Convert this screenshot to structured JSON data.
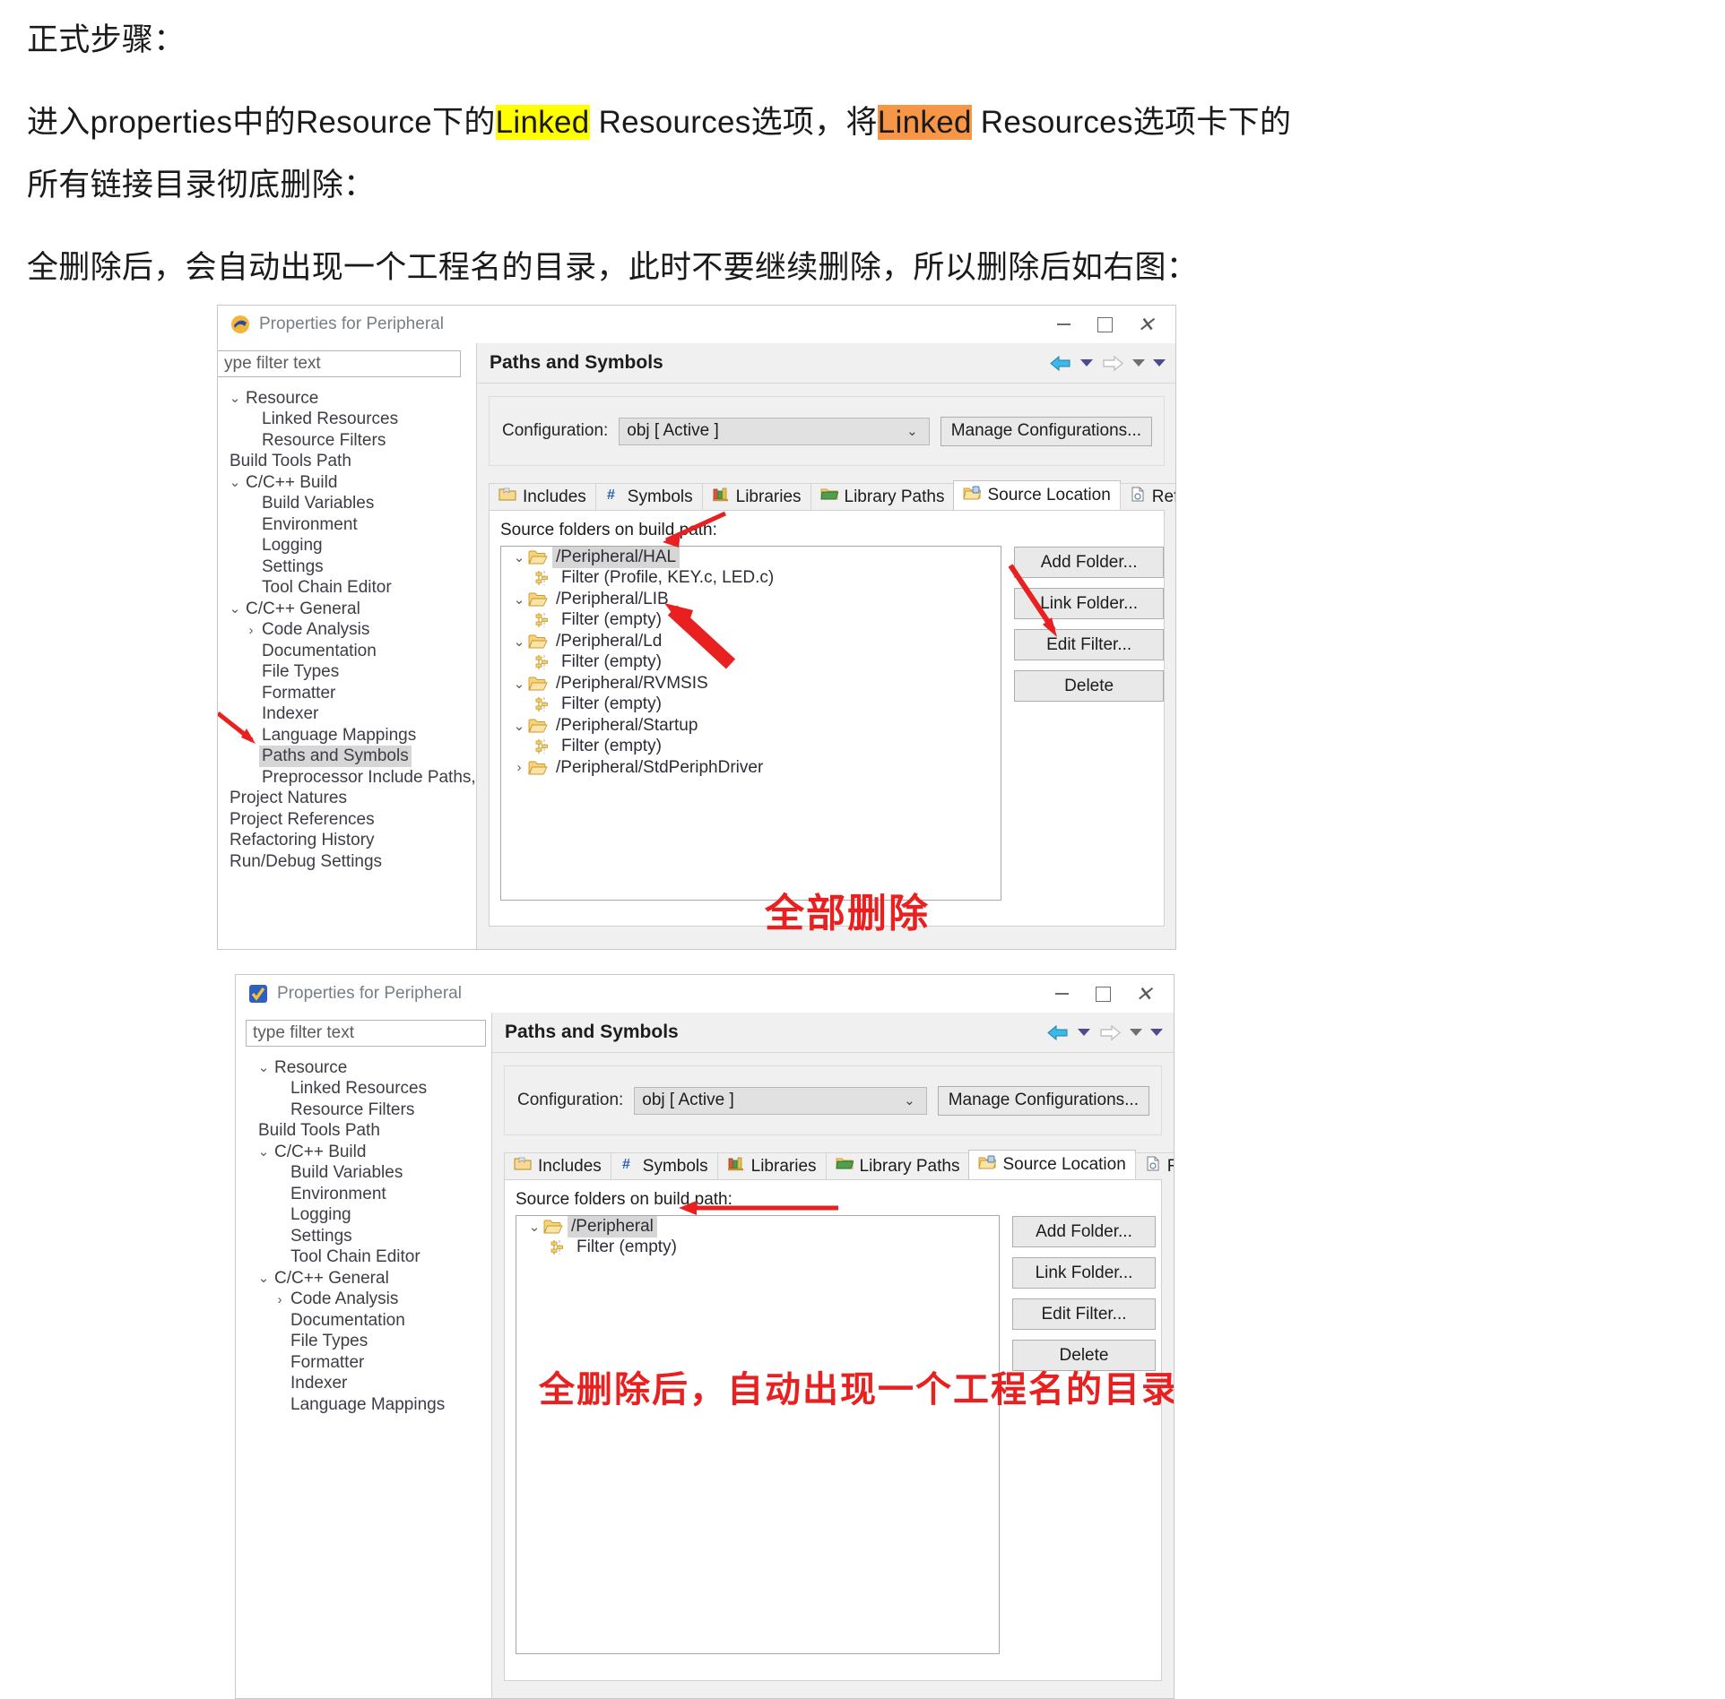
{
  "article": {
    "line1": "正式步骤：",
    "line2_a": "进入properties中的Resource下的",
    "line2_hl1": "Linked",
    "line2_b": " Resources选项，将",
    "line2_hl2": "Linked",
    "line2_c": " Resources选项卡下的",
    "line3": "所有链接目录彻底删除：",
    "line4": "全删除后，会自动出现一个工程名的目录，此时不要继续删除，所以删除后如右图："
  },
  "dialog1": {
    "title": "Properties for Peripheral",
    "window_buttons": {
      "minimize": "—",
      "maximize": "□",
      "close": "✕"
    },
    "filter_placeholder": "ype filter text",
    "tree": [
      {
        "label": "Resource",
        "level": 0,
        "twist": "⌄",
        "selected": false
      },
      {
        "label": "Linked Resources",
        "level": 1,
        "twist": "",
        "selected": false
      },
      {
        "label": "Resource Filters",
        "level": 1,
        "twist": "",
        "selected": false
      },
      {
        "label": "Build Tools Path",
        "level": 0,
        "twist": "",
        "selected": false
      },
      {
        "label": "C/C++ Build",
        "level": 0,
        "twist": "⌄",
        "selected": false
      },
      {
        "label": "Build Variables",
        "level": 1,
        "twist": "",
        "selected": false
      },
      {
        "label": "Environment",
        "level": 1,
        "twist": "",
        "selected": false
      },
      {
        "label": "Logging",
        "level": 1,
        "twist": "",
        "selected": false
      },
      {
        "label": "Settings",
        "level": 1,
        "twist": "",
        "selected": false
      },
      {
        "label": "Tool Chain Editor",
        "level": 1,
        "twist": "",
        "selected": false
      },
      {
        "label": "C/C++ General",
        "level": 0,
        "twist": "⌄",
        "selected": false
      },
      {
        "label": "Code Analysis",
        "level": 1,
        "twist": "›",
        "selected": false
      },
      {
        "label": "Documentation",
        "level": 1,
        "twist": "",
        "selected": false
      },
      {
        "label": "File Types",
        "level": 1,
        "twist": "",
        "selected": false
      },
      {
        "label": "Formatter",
        "level": 1,
        "twist": "",
        "selected": false
      },
      {
        "label": "Indexer",
        "level": 1,
        "twist": "",
        "selected": false
      },
      {
        "label": "Language Mappings",
        "level": 1,
        "twist": "",
        "selected": false
      },
      {
        "label": "Paths and Symbols",
        "level": 1,
        "twist": "",
        "selected": true
      },
      {
        "label": "Preprocessor Include Paths, Macı",
        "level": 1,
        "twist": "",
        "selected": false
      },
      {
        "label": "Project Natures",
        "level": 0,
        "twist": "",
        "selected": false
      },
      {
        "label": "Project References",
        "level": 0,
        "twist": "",
        "selected": false
      },
      {
        "label": "Refactoring History",
        "level": 0,
        "twist": "",
        "selected": false
      },
      {
        "label": "Run/Debug Settings",
        "level": 0,
        "twist": "",
        "selected": false
      }
    ],
    "page_title": "Paths and Symbols",
    "configuration_label": "Configuration:",
    "configuration_value": "obj  [ Active ]",
    "manage_configurations": "Manage Configurations...",
    "tabs": [
      {
        "label": "Includes",
        "icon": "includes-icon",
        "active": false
      },
      {
        "label": "Symbols",
        "icon": "hash-icon",
        "active": false
      },
      {
        "label": "Libraries",
        "icon": "books-icon",
        "active": false
      },
      {
        "label": "Library Paths",
        "icon": "folder-green-icon",
        "active": false
      },
      {
        "label": "Source Location",
        "icon": "folder-source-icon",
        "active": true
      },
      {
        "label": "References",
        "icon": "page-icon",
        "active": false
      }
    ],
    "source_folders_label": "Source folders on build path:",
    "source_tree": [
      {
        "label": "/Peripheral/HAL",
        "type": "folder",
        "twist": "⌄",
        "selected": true
      },
      {
        "label": "Filter (Profile, KEY.c, LED.c)",
        "type": "filter",
        "twist": "",
        "selected": false
      },
      {
        "label": "/Peripheral/LIB",
        "type": "folder",
        "twist": "⌄",
        "selected": false
      },
      {
        "label": "Filter (empty)",
        "type": "filter",
        "twist": "",
        "selected": false
      },
      {
        "label": "/Peripheral/Ld",
        "type": "folder",
        "twist": "⌄",
        "selected": false
      },
      {
        "label": "Filter (empty)",
        "type": "filter",
        "twist": "",
        "selected": false
      },
      {
        "label": "/Peripheral/RVMSIS",
        "type": "folder",
        "twist": "⌄",
        "selected": false
      },
      {
        "label": "Filter (empty)",
        "type": "filter",
        "twist": "",
        "selected": false
      },
      {
        "label": "/Peripheral/Startup",
        "type": "folder",
        "twist": "⌄",
        "selected": false
      },
      {
        "label": "Filter (empty)",
        "type": "filter",
        "twist": "",
        "selected": false
      },
      {
        "label": "/Peripheral/StdPeriphDriver",
        "type": "folder",
        "twist": "›",
        "selected": false
      }
    ],
    "side_buttons": [
      "Add Folder...",
      "Link Folder...",
      "Edit Filter...",
      "Delete"
    ],
    "annotation": "全部删除"
  },
  "dialog2": {
    "title": "Properties for Peripheral",
    "window_buttons": {
      "minimize": "—",
      "maximize": "□",
      "close": "✕"
    },
    "filter_placeholder": "type filter text",
    "tree": [
      {
        "label": "Resource",
        "level": 0,
        "twist": "⌄",
        "selected": false
      },
      {
        "label": "Linked Resources",
        "level": 1,
        "twist": "",
        "selected": false
      },
      {
        "label": "Resource Filters",
        "level": 1,
        "twist": "",
        "selected": false
      },
      {
        "label": "Build Tools Path",
        "level": 0,
        "twist": "",
        "selected": false
      },
      {
        "label": "C/C++ Build",
        "level": 0,
        "twist": "⌄",
        "selected": false
      },
      {
        "label": "Build Variables",
        "level": 1,
        "twist": "",
        "selected": false
      },
      {
        "label": "Environment",
        "level": 1,
        "twist": "",
        "selected": false
      },
      {
        "label": "Logging",
        "level": 1,
        "twist": "",
        "selected": false
      },
      {
        "label": "Settings",
        "level": 1,
        "twist": "",
        "selected": false
      },
      {
        "label": "Tool Chain Editor",
        "level": 1,
        "twist": "",
        "selected": false
      },
      {
        "label": "C/C++ General",
        "level": 0,
        "twist": "⌄",
        "selected": false
      },
      {
        "label": "Code Analysis",
        "level": 1,
        "twist": "›",
        "selected": false
      },
      {
        "label": "Documentation",
        "level": 1,
        "twist": "",
        "selected": false
      },
      {
        "label": "File Types",
        "level": 1,
        "twist": "",
        "selected": false
      },
      {
        "label": "Formatter",
        "level": 1,
        "twist": "",
        "selected": false
      },
      {
        "label": "Indexer",
        "level": 1,
        "twist": "",
        "selected": false
      },
      {
        "label": "Language Mappings",
        "level": 1,
        "twist": "",
        "selected": false
      }
    ],
    "page_title": "Paths and Symbols",
    "configuration_label": "Configuration:",
    "configuration_value": "obj  [ Active ]",
    "manage_configurations": "Manage Configurations...",
    "tabs": [
      {
        "label": "Includes",
        "icon": "includes-icon",
        "active": false
      },
      {
        "label": "Symbols",
        "icon": "hash-icon",
        "active": false
      },
      {
        "label": "Libraries",
        "icon": "books-icon",
        "active": false
      },
      {
        "label": "Library Paths",
        "icon": "folder-green-icon",
        "active": false
      },
      {
        "label": "Source Location",
        "icon": "folder-source-icon",
        "active": true
      },
      {
        "label": "References",
        "icon": "page-icon",
        "active": false
      }
    ],
    "source_folders_label": "Source folders on build path:",
    "source_tree": [
      {
        "label": "/Peripheral",
        "type": "folder",
        "twist": "⌄",
        "selected": true
      },
      {
        "label": "Filter (empty)",
        "type": "filter",
        "twist": "",
        "selected": false
      }
    ],
    "side_buttons": [
      "Add Folder...",
      "Link Folder...",
      "Edit Filter...",
      "Delete"
    ],
    "annotation": "全删除后，自动出现一个工程名的目录"
  },
  "colors": {
    "red_annotation": "#e8201f",
    "highlight_yellow": "#ffff00",
    "highlight_orange": "#f79646",
    "selection_gray": "#d6d6d6"
  }
}
